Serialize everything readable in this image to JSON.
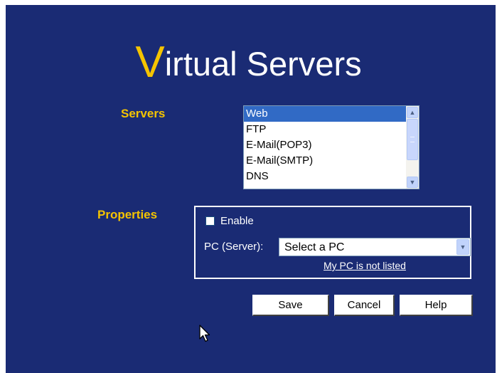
{
  "page": {
    "title_first_letter": "V",
    "title_rest": "irtual Servers",
    "colors": {
      "background": "#1a2b74",
      "accent": "#f5c400",
      "text": "#ffffff"
    }
  },
  "servers": {
    "label": "Servers",
    "items": [
      "Web",
      "FTP",
      "E-Mail(POP3)",
      "E-Mail(SMTP)",
      "DNS"
    ],
    "selected": "Web",
    "scroll_icons": {
      "up": "chevron-up-icon",
      "down": "chevron-down-icon"
    }
  },
  "properties": {
    "label": "Properties",
    "enable_label": "Enable",
    "enable_checked": false,
    "pc_label": "PC (Server):",
    "pc_select_value": "Select a PC",
    "not_listed_link": "My PC is not listed"
  },
  "buttons": {
    "save": "Save",
    "cancel": "Cancel",
    "help": "Help"
  }
}
